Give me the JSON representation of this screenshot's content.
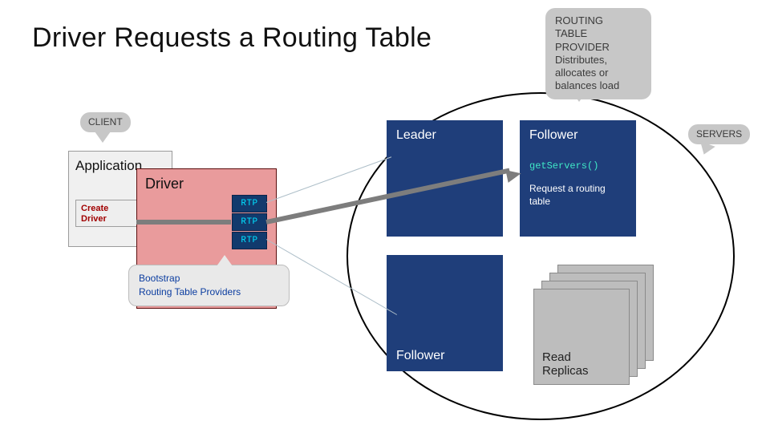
{
  "title": "Driver Requests a Routing Table",
  "callouts": {
    "client": "CLIENT",
    "servers": "SERVERS",
    "rtp": {
      "line1": "ROUTING",
      "line2": "TABLE",
      "line3": "PROVIDER",
      "line4": "Distributes, allocates or balances load"
    }
  },
  "application": {
    "title": "Application",
    "button": "Create Driver"
  },
  "driver": {
    "title": "Driver",
    "rtps": [
      "RTP",
      "RTP",
      "RTP"
    ],
    "bootstrap": {
      "line1": "Bootstrap",
      "line2": "Routing Table Providers"
    }
  },
  "servers": {
    "leader": "Leader",
    "follower_top": {
      "title": "Follower",
      "code": "getServers()",
      "subtitle": "Request a routing table"
    },
    "follower_bottom": "Follower",
    "replicas": {
      "line1": "Read",
      "line2": "Replicas"
    }
  }
}
